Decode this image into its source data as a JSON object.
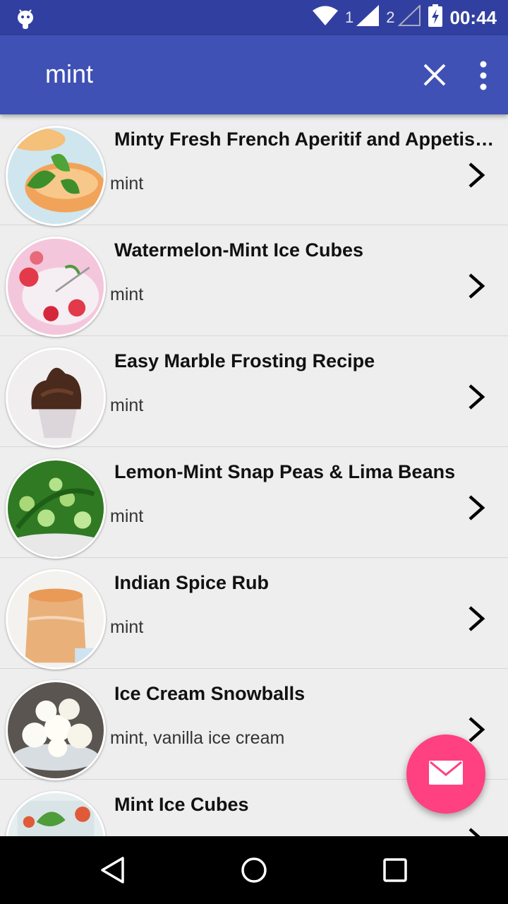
{
  "status_bar": {
    "time": "00:44",
    "sim1_label": "1",
    "sim2_label": "2",
    "icons": [
      "android-debug-icon",
      "wifi-icon",
      "signal-sim1-icon",
      "signal-sim2-icon",
      "battery-charging-icon"
    ]
  },
  "app_bar": {
    "search_query": "mint",
    "icons": [
      "close-icon",
      "more-vert-icon"
    ]
  },
  "results": [
    {
      "title": "Minty Fresh French Aperitif and Appetiser...",
      "ingredients": "mint"
    },
    {
      "title": "Watermelon-Mint Ice Cubes",
      "ingredients": "mint"
    },
    {
      "title": "Easy Marble Frosting Recipe",
      "ingredients": "mint"
    },
    {
      "title": "Lemon-Mint Snap Peas & Lima Beans",
      "ingredients": "mint"
    },
    {
      "title": "Indian Spice Rub",
      "ingredients": "mint"
    },
    {
      "title": "Ice Cream Snowballs",
      "ingredients": "mint, vanilla ice cream"
    },
    {
      "title": "Mint Ice Cubes",
      "ingredients": ""
    }
  ],
  "fab": {
    "icon": "email-icon"
  },
  "nav_bar": {
    "icons": [
      "back-icon",
      "home-icon",
      "recents-icon"
    ]
  },
  "colors": {
    "primary": "#3f51b5",
    "primary_dark": "#3140a0",
    "accent": "#ff4081",
    "background": "#eeeeee"
  }
}
